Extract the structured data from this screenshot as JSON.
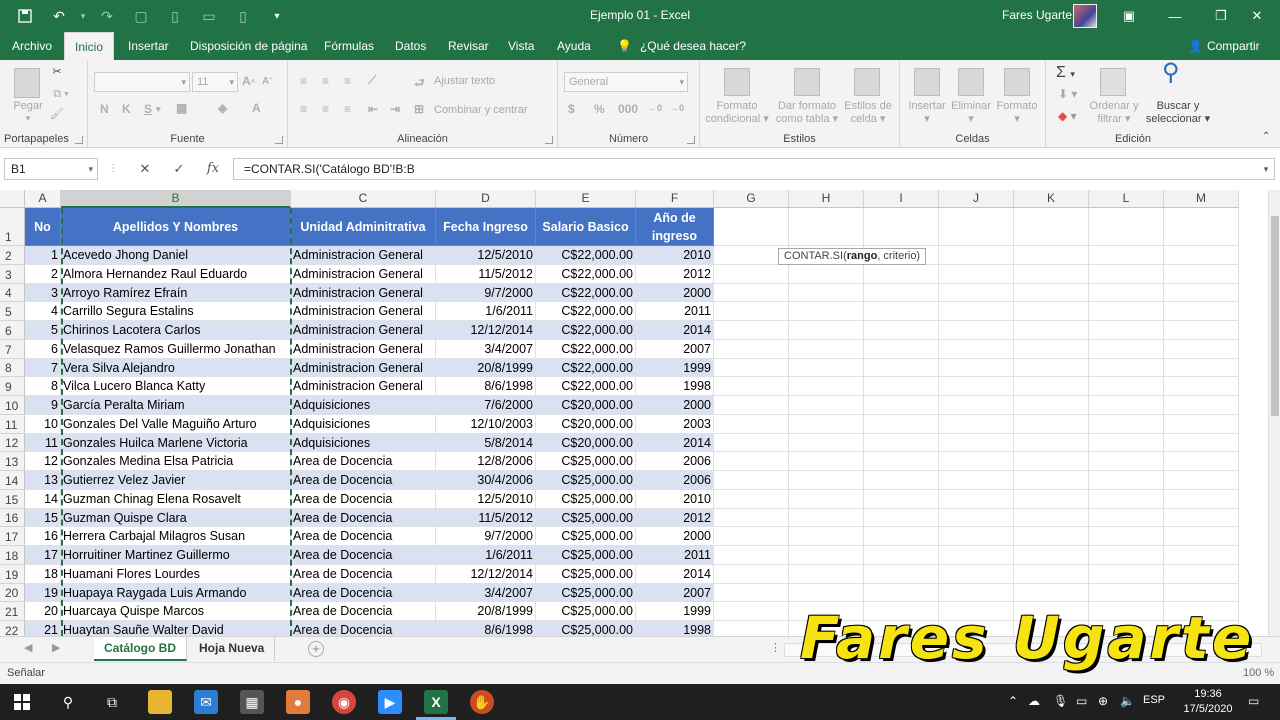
{
  "window": {
    "title": "Ejemplo 01  -  Excel",
    "user_name": "Fares Ugarte"
  },
  "menu": {
    "tabs": [
      "Archivo",
      "Inicio",
      "Insertar",
      "Disposición de página",
      "Fórmulas",
      "Datos",
      "Revisar",
      "Vista",
      "Ayuda"
    ],
    "tell_me": "¿Qué desea hacer?",
    "share": "Compartir"
  },
  "ribbon": {
    "clipboard": {
      "label": "Portapapeles",
      "paste": "Pegar"
    },
    "font": {
      "label": "Fuente",
      "size": "11",
      "bold": "N",
      "italic": "K",
      "underline": "S"
    },
    "alignment": {
      "label": "Alineación",
      "wrap": "Ajustar texto",
      "merge": "Combinar y centrar"
    },
    "number": {
      "label": "Número",
      "format": "General"
    },
    "styles": {
      "label": "Estilos",
      "conditional_1": "Formato",
      "conditional_2": "condicional",
      "table_1": "Dar formato",
      "table_2": "como tabla",
      "cell_1": "Estilos de",
      "cell_2": "celda"
    },
    "cells": {
      "label": "Celdas",
      "insert": "Insertar",
      "delete": "Eliminar",
      "format": "Formato"
    },
    "editing": {
      "label": "Edición",
      "sort_1": "Ordenar y",
      "sort_2": "filtrar",
      "find_1": "Buscar y",
      "find_2": "seleccionar"
    }
  },
  "formula_bar": {
    "name_box": "B1",
    "formula": "=CONTAR.SI('Catálogo BD'!B:B"
  },
  "sheet": {
    "columns": [
      "A",
      "B",
      "C",
      "D",
      "E",
      "F",
      "G",
      "H",
      "I",
      "J",
      "K",
      "L",
      "M"
    ],
    "headers": [
      "No",
      "Apellidos Y Nombres",
      "Unidad Adminitrativa",
      "Fecha Ingreso",
      "Salario Basico",
      "Año de ingreso"
    ],
    "rows": [
      [
        "1",
        "Acevedo Jhong Daniel",
        "Administracion General",
        "12/5/2010",
        "C$22,000.00",
        "2010"
      ],
      [
        "2",
        "Almora Hernandez Raul Eduardo",
        "Administracion General",
        "11/5/2012",
        "C$22,000.00",
        "2012"
      ],
      [
        "3",
        "Arroyo Ramírez Efraín",
        "Administracion General",
        "9/7/2000",
        "C$22,000.00",
        "2000"
      ],
      [
        "4",
        "Carrillo Segura Estalins",
        "Administracion General",
        "1/6/2011",
        "C$22,000.00",
        "2011"
      ],
      [
        "5",
        "Chirinos Lacotera Carlos",
        "Administracion General",
        "12/12/2014",
        "C$22,000.00",
        "2014"
      ],
      [
        "6",
        "Velasquez Ramos Guillermo Jonathan",
        "Administracion General",
        "3/4/2007",
        "C$22,000.00",
        "2007"
      ],
      [
        "7",
        "Vera Silva Alejandro",
        "Administracion General",
        "20/8/1999",
        "C$22,000.00",
        "1999"
      ],
      [
        "8",
        "Vilca Lucero Blanca Katty",
        "Administracion General",
        "8/6/1998",
        "C$22,000.00",
        "1998"
      ],
      [
        "9",
        "García Peralta Miriam",
        "Adquisiciones",
        "7/6/2000",
        "C$20,000.00",
        "2000"
      ],
      [
        "10",
        "Gonzales Del Valle Maguiño Arturo",
        "Adquisiciones",
        "12/10/2003",
        "C$20,000.00",
        "2003"
      ],
      [
        "11",
        "Gonzales Huilca Marlene Victoria",
        "Adquisiciones",
        "5/8/2014",
        "C$20,000.00",
        "2014"
      ],
      [
        "12",
        "Gonzales Medina Elsa Patricia",
        "Area de Docencia",
        "12/8/2006",
        "C$25,000.00",
        "2006"
      ],
      [
        "13",
        "Gutierrez Velez Javier",
        "Area de Docencia",
        "30/4/2006",
        "C$25,000.00",
        "2006"
      ],
      [
        "14",
        "Guzman Chinag Elena Rosavelt",
        "Area de Docencia",
        "12/5/2010",
        "C$25,000.00",
        "2010"
      ],
      [
        "15",
        "Guzman Quispe Clara",
        "Area de Docencia",
        "11/5/2012",
        "C$25,000.00",
        "2012"
      ],
      [
        "16",
        "Herrera Carbajal Milagros Susan",
        "Area de Docencia",
        "9/7/2000",
        "C$25,000.00",
        "2000"
      ],
      [
        "17",
        "Horruitiner Martinez Guillermo",
        "Area de Docencia",
        "1/6/2011",
        "C$25,000.00",
        "2011"
      ],
      [
        "18",
        "Huamani Flores Lourdes",
        "Area de Docencia",
        "12/12/2014",
        "C$25,000.00",
        "2014"
      ],
      [
        "19",
        "Huapaya Raygada Luis Armando",
        "Area de Docencia",
        "3/4/2007",
        "C$25,000.00",
        "2007"
      ],
      [
        "20",
        "Huarcaya Quispe Marcos",
        "Area de Docencia",
        "20/8/1999",
        "C$25,000.00",
        "1999"
      ],
      [
        "21",
        "Huaytan Sauñe Walter David",
        "Area de Docencia",
        "8/6/1998",
        "C$25,000.00",
        "1998"
      ]
    ],
    "tooltip_fn": "CONTAR.SI(",
    "tooltip_arg1": "rango",
    "tooltip_rest": ", criterio)"
  },
  "sheet_tabs": [
    "Catálogo BD",
    "Hoja Nueva"
  ],
  "status": {
    "mode": "Señalar",
    "zoom": "100 %"
  },
  "watermark": "Fares Ugarte",
  "taskbar": {
    "language": "ESP",
    "time": "19:36",
    "date": "17/5/2020"
  },
  "colors": {
    "excel_green": "#217346",
    "table_header": "#4472c4",
    "band": "#d9e1f2",
    "watermark": "#f5e312"
  }
}
